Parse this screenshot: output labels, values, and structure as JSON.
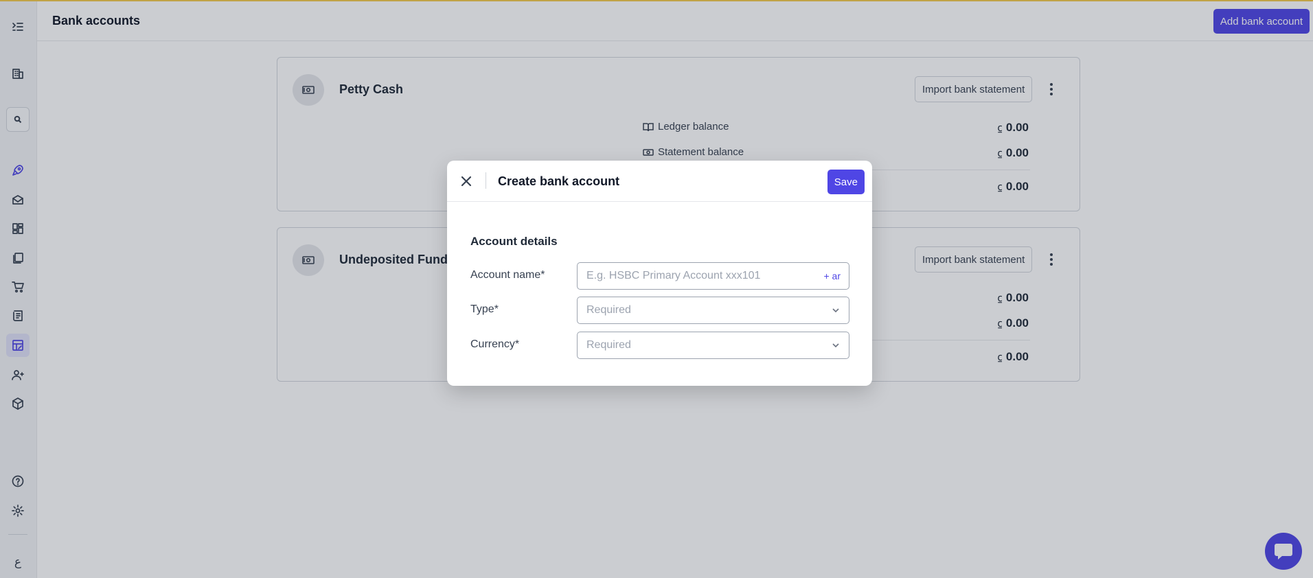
{
  "header": {
    "title": "Bank accounts",
    "add_button": "Add bank account"
  },
  "sidebar": {
    "lang_glyph": "ع",
    "icons": [
      "menu-icon",
      "building-icon",
      "search-icon",
      "rocket-icon",
      "inbox-icon",
      "dashboard-icon",
      "documents-icon",
      "cart-icon",
      "receipt-icon",
      "accounting-icon",
      "contacts-icon",
      "package-icon",
      "help-icon",
      "settings-icon"
    ]
  },
  "accounts": [
    {
      "name": "Petty Cash",
      "import_label": "Import bank statement",
      "ledger_label": "Ledger balance",
      "statement_label": "Statement balance",
      "currency_symbol": "⃀",
      "ledger_value": "0.00",
      "statement_value": "0.00",
      "diff_value": "0.00"
    },
    {
      "name": "Undeposited Funds",
      "import_label": "Import bank statement",
      "currency_symbol": "⃀",
      "ledger_value": "0.00",
      "statement_value": "0.00",
      "diff_value": "0.00"
    }
  ],
  "modal": {
    "title": "Create bank account",
    "save": "Save",
    "section": "Account details",
    "fields": {
      "name": {
        "label": "Account name*",
        "placeholder": "E.g. HSBC Primary Account xxx101",
        "lang": "+ ar"
      },
      "type": {
        "label": "Type*",
        "placeholder": "Required"
      },
      "currency": {
        "label": "Currency*",
        "placeholder": "Required"
      }
    }
  },
  "colors": {
    "accent": "#4f46e5",
    "top_line": "#f2c94c",
    "overlay": "#1f2937"
  }
}
